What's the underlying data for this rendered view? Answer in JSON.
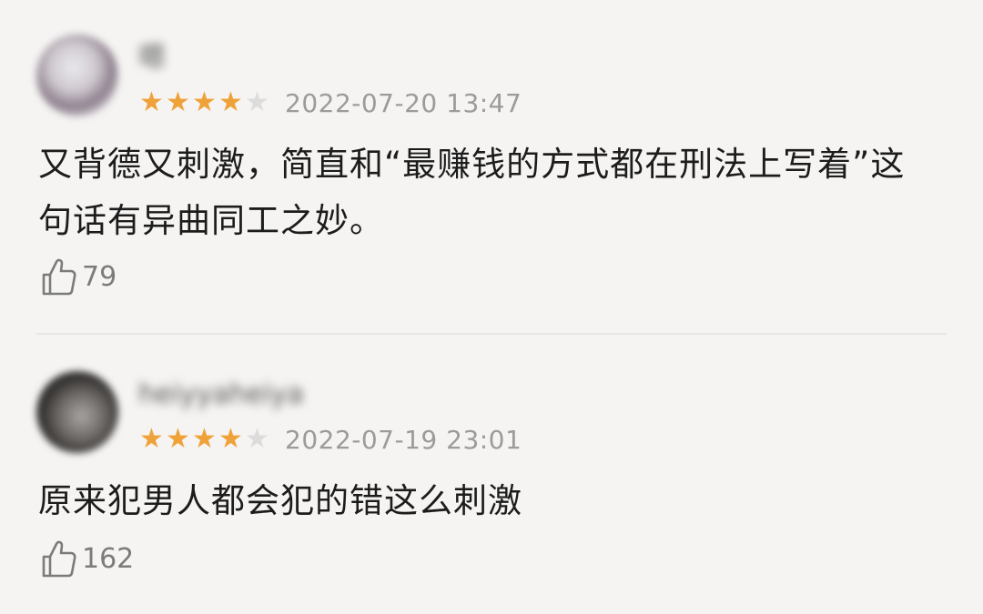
{
  "reviews": [
    {
      "username": "嗯",
      "rating": 4,
      "max_rating": 5,
      "date": "2022-07-20 13:47",
      "content": "又背德又刺激，简直和“最赚钱的方式都在刑法上写着”这句话有异曲同工之妙。",
      "likes": "79"
    },
    {
      "username": "heiyyaheiya",
      "rating": 4,
      "max_rating": 5,
      "date": "2022-07-19 23:01",
      "content": "原来犯男人都会犯的错这么刺激",
      "likes": "162"
    }
  ],
  "colors": {
    "star_on": "#f0a23a",
    "star_off": "#dcdcdc",
    "background": "#f5f4f2"
  },
  "icons": {
    "like": "thumbs-up-icon",
    "star": "star-icon"
  }
}
